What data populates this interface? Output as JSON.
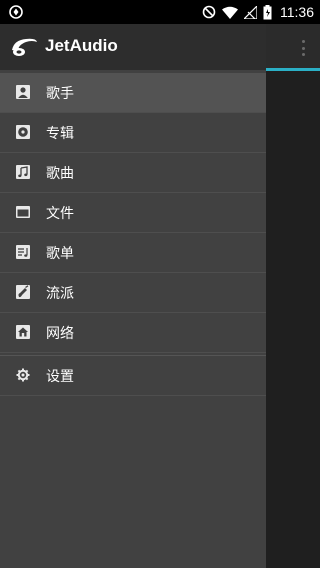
{
  "status_bar": {
    "time": "11:36"
  },
  "drawer": {
    "title": "JetAudio",
    "items": [
      {
        "label": "歌手",
        "icon": "artist-icon"
      },
      {
        "label": "专辑",
        "icon": "album-icon"
      },
      {
        "label": "歌曲",
        "icon": "song-icon"
      },
      {
        "label": "文件",
        "icon": "folder-icon"
      },
      {
        "label": "歌单",
        "icon": "playlist-icon"
      },
      {
        "label": "流派",
        "icon": "genre-icon"
      },
      {
        "label": "网络",
        "icon": "network-icon"
      }
    ],
    "settings_label": "设置",
    "active_index": 0
  },
  "colors": {
    "accent": "#2bb0c6",
    "drawer_bg": "#414141",
    "header_bg": "#2d2d2d"
  }
}
